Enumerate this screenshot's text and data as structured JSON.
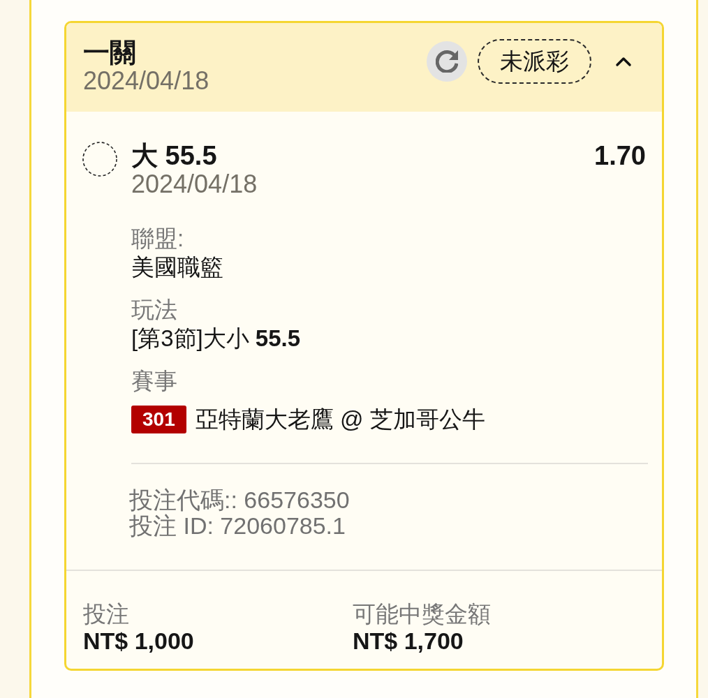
{
  "bet_card": {
    "title": "一關",
    "date": "2024/04/18",
    "status": "未派彩",
    "expanded": true,
    "selection": {
      "name": "大 55.5",
      "date": "2024/04/18",
      "odds": "1.70"
    },
    "details": [
      {
        "kind": "text",
        "label": "聯盟:",
        "value": "美國職籃"
      },
      {
        "kind": "text",
        "label": "玩法",
        "value": "[第3節]大小 **55.5**"
      },
      {
        "kind": "match",
        "label": "賽事",
        "event_number": "301",
        "value": "亞特蘭大老鷹 @ 芝加哥公牛"
      }
    ],
    "codes": [
      "投注代碼:: 66576350",
      "投注 ID: 72060785.1"
    ],
    "totals": [
      {
        "label": "投注",
        "value": "NT$ 1,000"
      },
      {
        "label": "可能中獎金額",
        "value": "NT$ 1,700"
      }
    ]
  }
}
